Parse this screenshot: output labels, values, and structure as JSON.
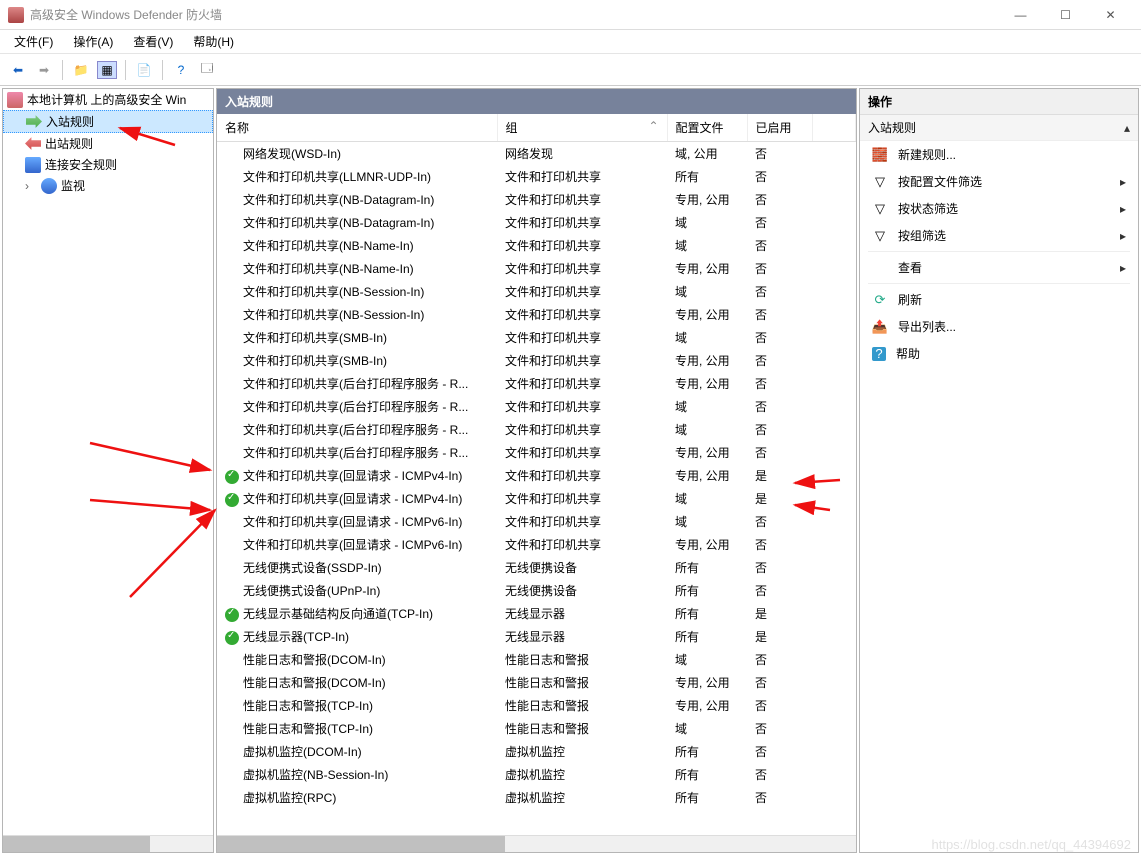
{
  "window": {
    "title": "高级安全 Windows Defender 防火墙"
  },
  "menu": {
    "file": "文件(F)",
    "action": "操作(A)",
    "view": "查看(V)",
    "help": "帮助(H)"
  },
  "tree": {
    "root": "本地计算机 上的高级安全 Win",
    "inbound": "入站规则",
    "outbound": "出站规则",
    "connsec": "连接安全规则",
    "monitor": "监视"
  },
  "list": {
    "title": "入站规则",
    "columns": {
      "name": "名称",
      "group": "组",
      "profile": "配置文件",
      "enabled": "已启用"
    },
    "rows": [
      {
        "name": "网络发现(WSD-In)",
        "group": "网络发现",
        "profile": "域, 公用",
        "enabled": "否",
        "on": false
      },
      {
        "name": "文件和打印机共享(LLMNR-UDP-In)",
        "group": "文件和打印机共享",
        "profile": "所有",
        "enabled": "否",
        "on": false
      },
      {
        "name": "文件和打印机共享(NB-Datagram-In)",
        "group": "文件和打印机共享",
        "profile": "专用, 公用",
        "enabled": "否",
        "on": false
      },
      {
        "name": "文件和打印机共享(NB-Datagram-In)",
        "group": "文件和打印机共享",
        "profile": "域",
        "enabled": "否",
        "on": false
      },
      {
        "name": "文件和打印机共享(NB-Name-In)",
        "group": "文件和打印机共享",
        "profile": "域",
        "enabled": "否",
        "on": false
      },
      {
        "name": "文件和打印机共享(NB-Name-In)",
        "group": "文件和打印机共享",
        "profile": "专用, 公用",
        "enabled": "否",
        "on": false
      },
      {
        "name": "文件和打印机共享(NB-Session-In)",
        "group": "文件和打印机共享",
        "profile": "域",
        "enabled": "否",
        "on": false
      },
      {
        "name": "文件和打印机共享(NB-Session-In)",
        "group": "文件和打印机共享",
        "profile": "专用, 公用",
        "enabled": "否",
        "on": false
      },
      {
        "name": "文件和打印机共享(SMB-In)",
        "group": "文件和打印机共享",
        "profile": "域",
        "enabled": "否",
        "on": false
      },
      {
        "name": "文件和打印机共享(SMB-In)",
        "group": "文件和打印机共享",
        "profile": "专用, 公用",
        "enabled": "否",
        "on": false
      },
      {
        "name": "文件和打印机共享(后台打印程序服务 - R...",
        "group": "文件和打印机共享",
        "profile": "专用, 公用",
        "enabled": "否",
        "on": false
      },
      {
        "name": "文件和打印机共享(后台打印程序服务 - R...",
        "group": "文件和打印机共享",
        "profile": "域",
        "enabled": "否",
        "on": false
      },
      {
        "name": "文件和打印机共享(后台打印程序服务 - R...",
        "group": "文件和打印机共享",
        "profile": "域",
        "enabled": "否",
        "on": false
      },
      {
        "name": "文件和打印机共享(后台打印程序服务 - R...",
        "group": "文件和打印机共享",
        "profile": "专用, 公用",
        "enabled": "否",
        "on": false
      },
      {
        "name": "文件和打印机共享(回显请求 - ICMPv4-In)",
        "group": "文件和打印机共享",
        "profile": "专用, 公用",
        "enabled": "是",
        "on": true
      },
      {
        "name": "文件和打印机共享(回显请求 - ICMPv4-In)",
        "group": "文件和打印机共享",
        "profile": "域",
        "enabled": "是",
        "on": true
      },
      {
        "name": "文件和打印机共享(回显请求 - ICMPv6-In)",
        "group": "文件和打印机共享",
        "profile": "域",
        "enabled": "否",
        "on": false
      },
      {
        "name": "文件和打印机共享(回显请求 - ICMPv6-In)",
        "group": "文件和打印机共享",
        "profile": "专用, 公用",
        "enabled": "否",
        "on": false
      },
      {
        "name": "无线便携式设备(SSDP-In)",
        "group": "无线便携设备",
        "profile": "所有",
        "enabled": "否",
        "on": false
      },
      {
        "name": "无线便携式设备(UPnP-In)",
        "group": "无线便携设备",
        "profile": "所有",
        "enabled": "否",
        "on": false
      },
      {
        "name": "无线显示基础结构反向通道(TCP-In)",
        "group": "无线显示器",
        "profile": "所有",
        "enabled": "是",
        "on": true
      },
      {
        "name": "无线显示器(TCP-In)",
        "group": "无线显示器",
        "profile": "所有",
        "enabled": "是",
        "on": true
      },
      {
        "name": "性能日志和警报(DCOM-In)",
        "group": "性能日志和警报",
        "profile": "域",
        "enabled": "否",
        "on": false
      },
      {
        "name": "性能日志和警报(DCOM-In)",
        "group": "性能日志和警报",
        "profile": "专用, 公用",
        "enabled": "否",
        "on": false
      },
      {
        "name": "性能日志和警报(TCP-In)",
        "group": "性能日志和警报",
        "profile": "专用, 公用",
        "enabled": "否",
        "on": false
      },
      {
        "name": "性能日志和警报(TCP-In)",
        "group": "性能日志和警报",
        "profile": "域",
        "enabled": "否",
        "on": false
      },
      {
        "name": "虚拟机监控(DCOM-In)",
        "group": "虚拟机监控",
        "profile": "所有",
        "enabled": "否",
        "on": false
      },
      {
        "name": "虚拟机监控(NB-Session-In)",
        "group": "虚拟机监控",
        "profile": "所有",
        "enabled": "否",
        "on": false
      },
      {
        "name": "虚拟机监控(RPC)",
        "group": "虚拟机监控",
        "profile": "所有",
        "enabled": "否",
        "on": false
      }
    ]
  },
  "actions": {
    "header": "操作",
    "sub": "入站规则",
    "newrule": "新建规则...",
    "byprofile": "按配置文件筛选",
    "bystate": "按状态筛选",
    "bygroup": "按组筛选",
    "view": "查看",
    "refresh": "刷新",
    "export": "导出列表...",
    "help": "帮助"
  },
  "watermark": "https://blog.csdn.net/qq_44394692"
}
